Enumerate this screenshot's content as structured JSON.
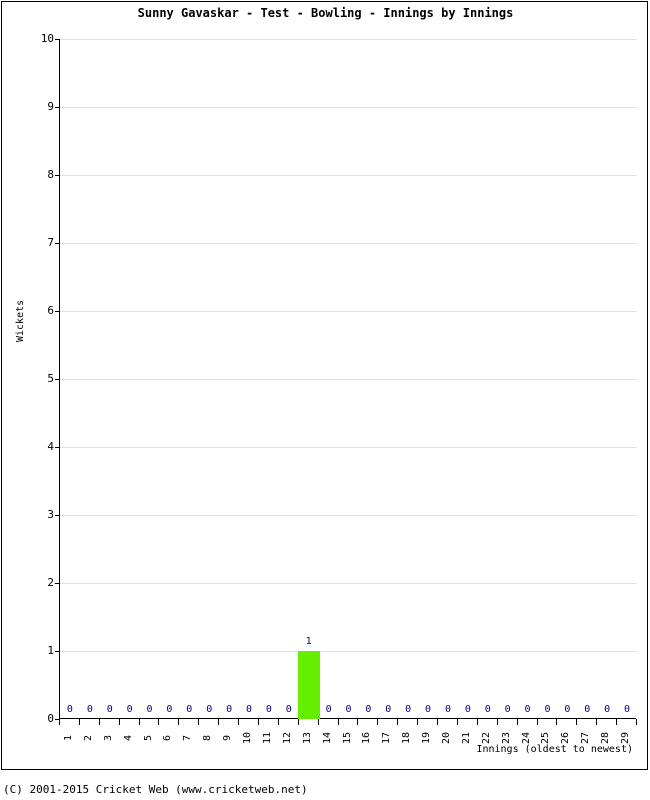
{
  "chart_data": {
    "type": "bar",
    "title": "Sunny Gavaskar - Test - Bowling - Innings by Innings",
    "xlabel": "Innings (oldest to newest)",
    "ylabel": "Wickets",
    "ylim": [
      0,
      10
    ],
    "ytick_labels": [
      "0",
      "1",
      "2",
      "3",
      "4",
      "5",
      "6",
      "7",
      "8",
      "9",
      "10"
    ],
    "yticks": [
      0,
      1,
      2,
      3,
      4,
      5,
      6,
      7,
      8,
      9,
      10
    ],
    "grid": true,
    "legend": null,
    "bar_color": "#66ee00",
    "value_label_color": "#000080",
    "categories": [
      "1",
      "2",
      "3",
      "4",
      "5",
      "6",
      "7",
      "8",
      "9",
      "10",
      "11",
      "12",
      "13",
      "14",
      "15",
      "16",
      "17",
      "18",
      "19",
      "20",
      "21",
      "22",
      "23",
      "24",
      "25",
      "26",
      "27",
      "28",
      "29"
    ],
    "values": [
      0,
      0,
      0,
      0,
      0,
      0,
      0,
      0,
      0,
      0,
      0,
      0,
      1,
      0,
      0,
      0,
      0,
      0,
      0,
      0,
      0,
      0,
      0,
      0,
      0,
      0,
      0,
      0,
      0
    ],
    "value_labels": [
      "0",
      "0",
      "0",
      "0",
      "0",
      "0",
      "0",
      "0",
      "0",
      "0",
      "0",
      "0",
      "1",
      "0",
      "0",
      "0",
      "0",
      "0",
      "0",
      "0",
      "0",
      "0",
      "0",
      "0",
      "0",
      "0",
      "0",
      "0",
      "0"
    ]
  },
  "footer": {
    "copyright": "(C) 2001-2015 Cricket Web (www.cricketweb.net)"
  }
}
